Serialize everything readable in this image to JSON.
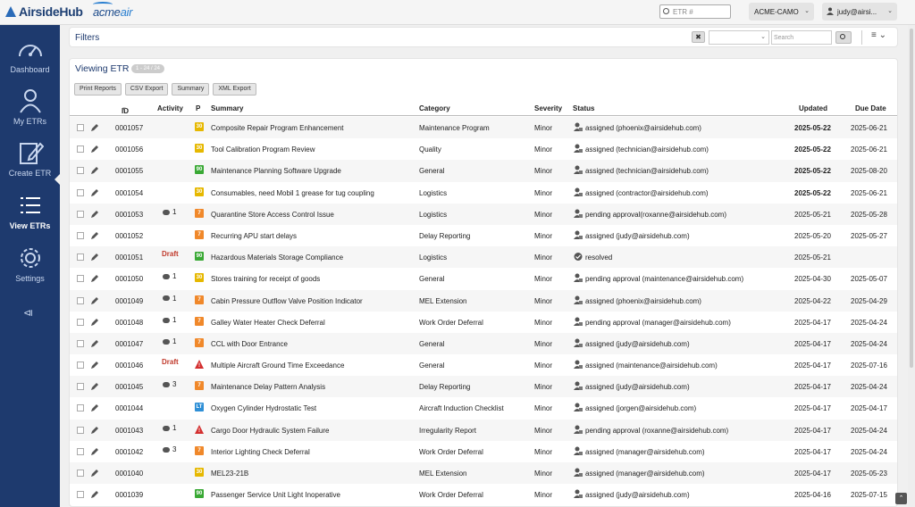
{
  "brand": {
    "name": "AirsideHub",
    "partner_a": "acme",
    "partner_b": "air"
  },
  "header": {
    "etr_search_placeholder": "ETR #",
    "org": "ACME-CAMO",
    "user": "judy@airsi..."
  },
  "sidebar": {
    "items": [
      {
        "label": "Dashboard",
        "icon": "gauge-icon"
      },
      {
        "label": "My ETRs",
        "icon": "user-icon"
      },
      {
        "label": "Create ETR",
        "icon": "edit-icon"
      },
      {
        "label": "View ETRs",
        "icon": "list-icon",
        "active": true
      },
      {
        "label": "Settings",
        "icon": "gear-icon"
      }
    ],
    "collapse_icon": "collapse-icon"
  },
  "filters": {
    "title": "Filters",
    "clear": "✖",
    "search_placeholder": "Search"
  },
  "panel": {
    "title": "Viewing ETR",
    "count_badge": "1 - 24 / 24",
    "buttons": [
      "Print Reports",
      "CSV Export",
      "Summary",
      "XML Export"
    ]
  },
  "table": {
    "headers": {
      "id": "ID",
      "activity": "Activity",
      "priority": "P",
      "summary": "Summary",
      "category": "Category",
      "severity": "Severity",
      "status": "Status",
      "updated": "Updated",
      "due": "Due Date"
    },
    "rows": [
      {
        "id": "0001057",
        "activity": "",
        "pri": "30",
        "summary": "Composite Repair Program Enhancement",
        "category": "Maintenance Program",
        "severity": "Minor",
        "status": "assigned (phoenix@airsidehub.com)",
        "updated": "2025-05-22",
        "updated_bold": true,
        "due": "2025-06-21"
      },
      {
        "id": "0001056",
        "activity": "",
        "pri": "30",
        "summary": "Tool Calibration Program Review",
        "category": "Quality",
        "severity": "Minor",
        "status": "assigned (technician@airsidehub.com)",
        "updated": "2025-05-22",
        "updated_bold": true,
        "due": "2025-06-21"
      },
      {
        "id": "0001055",
        "activity": "",
        "pri": "90",
        "summary": "Maintenance Planning Software Upgrade",
        "category": "General",
        "severity": "Minor",
        "status": "assigned (technician@airsidehub.com)",
        "updated": "2025-05-22",
        "updated_bold": true,
        "due": "2025-08-20"
      },
      {
        "id": "0001054",
        "activity": "",
        "pri": "30",
        "summary": "Consumables, need Mobil 1 grease for tug coupling",
        "category": "Logistics",
        "severity": "Minor",
        "status": "assigned (contractor@airsidehub.com)",
        "updated": "2025-05-22",
        "updated_bold": true,
        "due": "2025-06-21"
      },
      {
        "id": "0001053",
        "activity": "1",
        "pri": "7",
        "summary": "Quarantine Store Access Control Issue",
        "category": "Logistics",
        "severity": "Minor",
        "status": "pending approval(roxanne@airsidehub.com)",
        "updated": "2025-05-21",
        "due": "2025-05-28"
      },
      {
        "id": "0001052",
        "activity": "",
        "pri": "7",
        "summary": "Recurring APU start delays",
        "category": "Delay Reporting",
        "severity": "Minor",
        "status": "assigned (judy@airsidehub.com)",
        "updated": "2025-05-20",
        "due": "2025-05-27"
      },
      {
        "id": "0001051",
        "activity": "Draft",
        "pri": "90",
        "summary": "Hazardous Materials Storage Compliance",
        "category": "Logistics",
        "severity": "Minor",
        "status": "resolved",
        "status_type": "resolved",
        "updated": "2025-05-21",
        "due": ""
      },
      {
        "id": "0001050",
        "activity": "1",
        "pri": "30",
        "summary": "Stores training for receipt of goods",
        "category": "General",
        "severity": "Minor",
        "status": "pending approval (maintenance@airsidehub.com)",
        "updated": "2025-04-30",
        "due": "2025-05-07"
      },
      {
        "id": "0001049",
        "activity": "1",
        "pri": "7",
        "summary": "Cabin Pressure Outflow Valve Position Indicator",
        "category": "MEL Extension",
        "severity": "Minor",
        "status": "assigned (phoenix@airsidehub.com)",
        "updated": "2025-04-22",
        "due": "2025-04-29"
      },
      {
        "id": "0001048",
        "activity": "1",
        "pri": "7",
        "summary": "Galley Water Heater Check Deferral",
        "category": "Work Order Deferral",
        "severity": "Minor",
        "status": "pending approval (manager@airsidehub.com)",
        "updated": "2025-04-17",
        "due": "2025-04-24"
      },
      {
        "id": "0001047",
        "activity": "1",
        "pri": "7",
        "summary": "CCL with Door Entrance",
        "category": "General",
        "severity": "Minor",
        "status": "assigned (judy@airsidehub.com)",
        "updated": "2025-04-17",
        "due": "2025-04-24"
      },
      {
        "id": "0001046",
        "activity": "Draft",
        "pri": "!",
        "summary": "Multiple Aircraft Ground Time Exceedance",
        "category": "General",
        "severity": "Minor",
        "status": "assigned (maintenance@airsidehub.com)",
        "updated": "2025-04-17",
        "due": "2025-07-16"
      },
      {
        "id": "0001045",
        "activity": "3",
        "pri": "7",
        "summary": "Maintenance Delay Pattern Analysis",
        "category": "Delay Reporting",
        "severity": "Minor",
        "status": "assigned (judy@airsidehub.com)",
        "updated": "2025-04-17",
        "due": "2025-04-24"
      },
      {
        "id": "0001044",
        "activity": "",
        "pri": "LT",
        "summary": "Oxygen Cylinder Hydrostatic Test",
        "category": "Aircraft Induction Checklist",
        "severity": "Minor",
        "status": "assigned (jorgen@airsidehub.com)",
        "updated": "2025-04-17",
        "due": "2025-04-17"
      },
      {
        "id": "0001043",
        "activity": "1",
        "pri": "!",
        "summary": "Cargo Door Hydraulic System Failure",
        "category": "Irregularity Report",
        "severity": "Minor",
        "status": "pending approval (roxanne@airsidehub.com)",
        "updated": "2025-04-17",
        "due": "2025-04-24"
      },
      {
        "id": "0001042",
        "activity": "3",
        "pri": "7",
        "summary": "Interior Lighting Check Deferral",
        "category": "Work Order Deferral",
        "severity": "Minor",
        "status": "assigned (manager@airsidehub.com)",
        "updated": "2025-04-17",
        "due": "2025-04-24"
      },
      {
        "id": "0001040",
        "activity": "",
        "pri": "30",
        "summary": "MEL23-21B",
        "category": "MEL Extension",
        "severity": "Minor",
        "status": "assigned (manager@airsidehub.com)",
        "updated": "2025-04-17",
        "due": "2025-05-23"
      },
      {
        "id": "0001039",
        "activity": "",
        "pri": "90",
        "summary": "Passenger Service Unit Light Inoperative",
        "category": "Work Order Deferral",
        "severity": "Minor",
        "status": "assigned (judy@airsidehub.com)",
        "updated": "2025-04-16",
        "due": "2025-07-15"
      }
    ]
  },
  "priority_colors": {
    "30": "#e6b800",
    "90": "#3aa935",
    "7": "#f0882a",
    "LT": "#2e8fd6",
    "!": "#d32f2f"
  }
}
